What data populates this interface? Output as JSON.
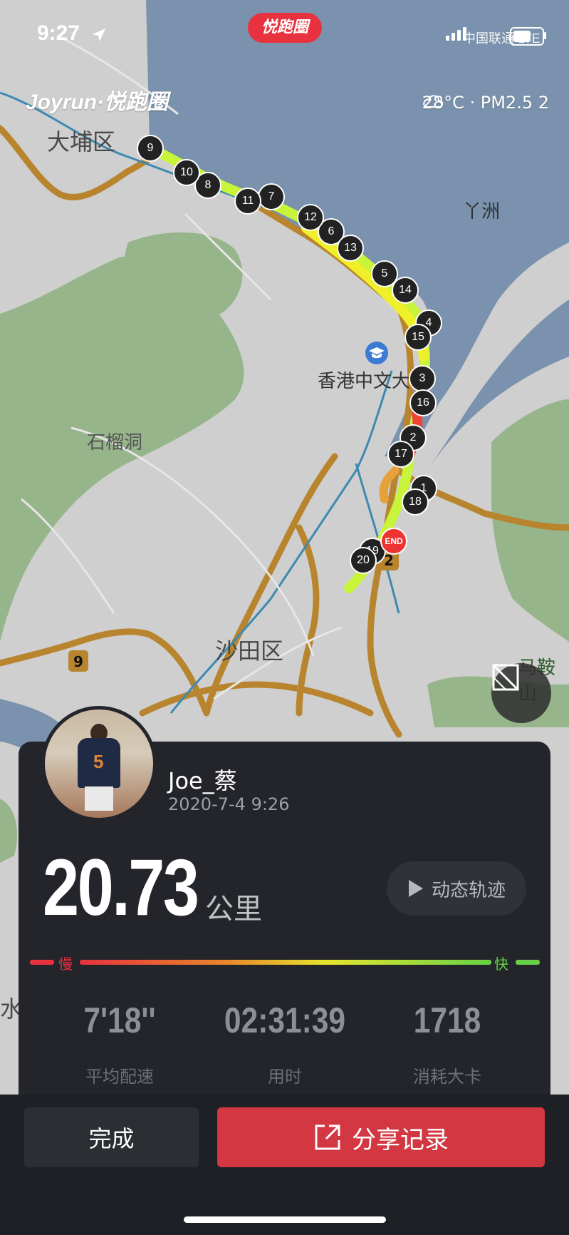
{
  "status": {
    "time": "9:27",
    "app_pill": "悦跑圈",
    "carrier": "中国联通 LTE"
  },
  "map": {
    "brand": "Joyrun·悦跑圈",
    "weather": "28°C · PM2.5 2",
    "labels": {
      "tai_po": "大埔区",
      "ya_chau": "丫洲",
      "cuhk": "香港中文大",
      "shek_lau_tung": "石榴洞",
      "sha_tin": "沙田区",
      "ma_on_shan": "马鞍山",
      "shui": "水"
    },
    "road_badges": {
      "route9": "9",
      "route2": "2"
    },
    "km_markers": [
      "1",
      "2",
      "3",
      "4",
      "5",
      "6",
      "7",
      "8",
      "9",
      "10",
      "11",
      "12",
      "13",
      "14",
      "15",
      "16",
      "17",
      "18",
      "19",
      "20"
    ],
    "end_label": "END"
  },
  "card": {
    "username": "Joe_蔡",
    "datetime": "2020-7-4 9:26",
    "distance": "20.73",
    "distance_unit": "公里",
    "replay_label": "动态轨迹",
    "slow_label": "慢",
    "fast_label": "快",
    "stats": [
      {
        "value": "7'18''",
        "label": "平均配速"
      },
      {
        "value": "02:31:39",
        "label": "用时"
      },
      {
        "value": "1718",
        "label": "消耗大卡"
      }
    ]
  },
  "actions": {
    "done_label": "完成",
    "share_label": "分享记录"
  },
  "colors": {
    "accent_red": "#d23742",
    "fast_green": "#66d146",
    "slow_red": "#e8323f"
  }
}
